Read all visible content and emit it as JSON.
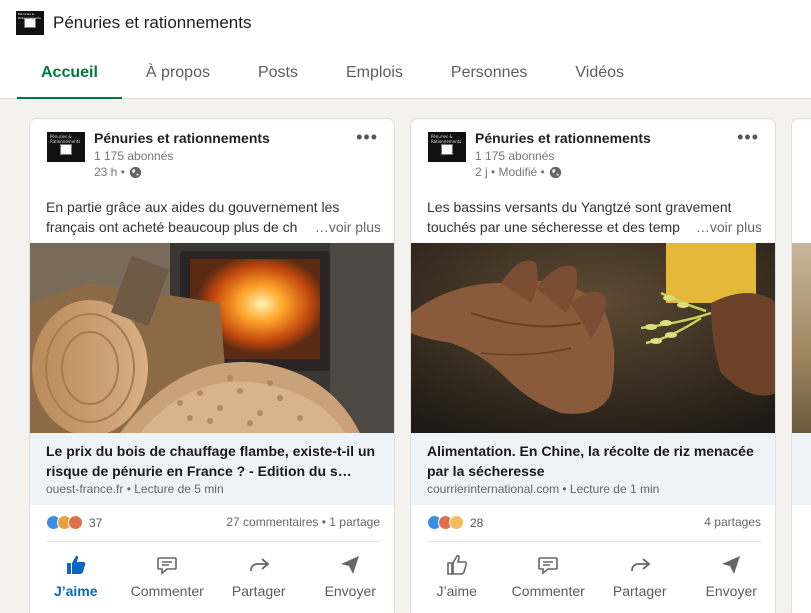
{
  "header": {
    "page_title": "Pénuries et rationnements",
    "logo_text": "Pénuries & Rationnements",
    "tabs": [
      {
        "label": "Accueil",
        "active": true
      },
      {
        "label": "À propos",
        "active": false
      },
      {
        "label": "Posts",
        "active": false
      },
      {
        "label": "Emplois",
        "active": false
      },
      {
        "label": "Personnes",
        "active": false
      },
      {
        "label": "Vidéos",
        "active": false
      }
    ]
  },
  "colors": {
    "accent_green": "#057642",
    "like_blue": "#0a66c2",
    "link_box_bg": "#eef3f8"
  },
  "posts": [
    {
      "author": "Pénuries et rationnements",
      "followers": "1 175 abonnés",
      "time": "23 h •",
      "text_line1": "En partie grâce aux aides du gouvernement les",
      "text_line2": "français ont acheté beaucoup plus de ch",
      "see_more": "…voir plus",
      "link_title": "Le prix du bois de chauffage flambe, existe-t-il un risque de pénurie en France ? - Edition du s…",
      "link_meta": "ouest-france.fr • Lecture de 5 min",
      "reaction_count": "37",
      "engagement": "27 commentaires • 1 partage",
      "image": "firewood-pellets-stove-image",
      "actions": {
        "like": "J’aime",
        "comment": "Commenter",
        "share": "Partager",
        "send": "Envoyer"
      },
      "liked": true
    },
    {
      "author": "Pénuries et rationnements",
      "followers": "1 175 abonnés",
      "time": "2 j • Modifié •",
      "text_line1": "Les bassins versants du Yangtzé sont gravement",
      "text_line2": "touchés par une sécheresse et des temp",
      "see_more": "…voir plus",
      "link_title": "Alimentation. En Chine, la récolte de riz menacée par la sécheresse",
      "link_meta": "courrierinternational.com • Lecture de 1 min",
      "reaction_count": "28",
      "engagement": "4 partages",
      "image": "hands-rice-plant-image",
      "actions": {
        "like": "J’aime",
        "comment": "Commenter",
        "share": "Partager",
        "send": "Envoyer"
      },
      "liked": false
    }
  ]
}
